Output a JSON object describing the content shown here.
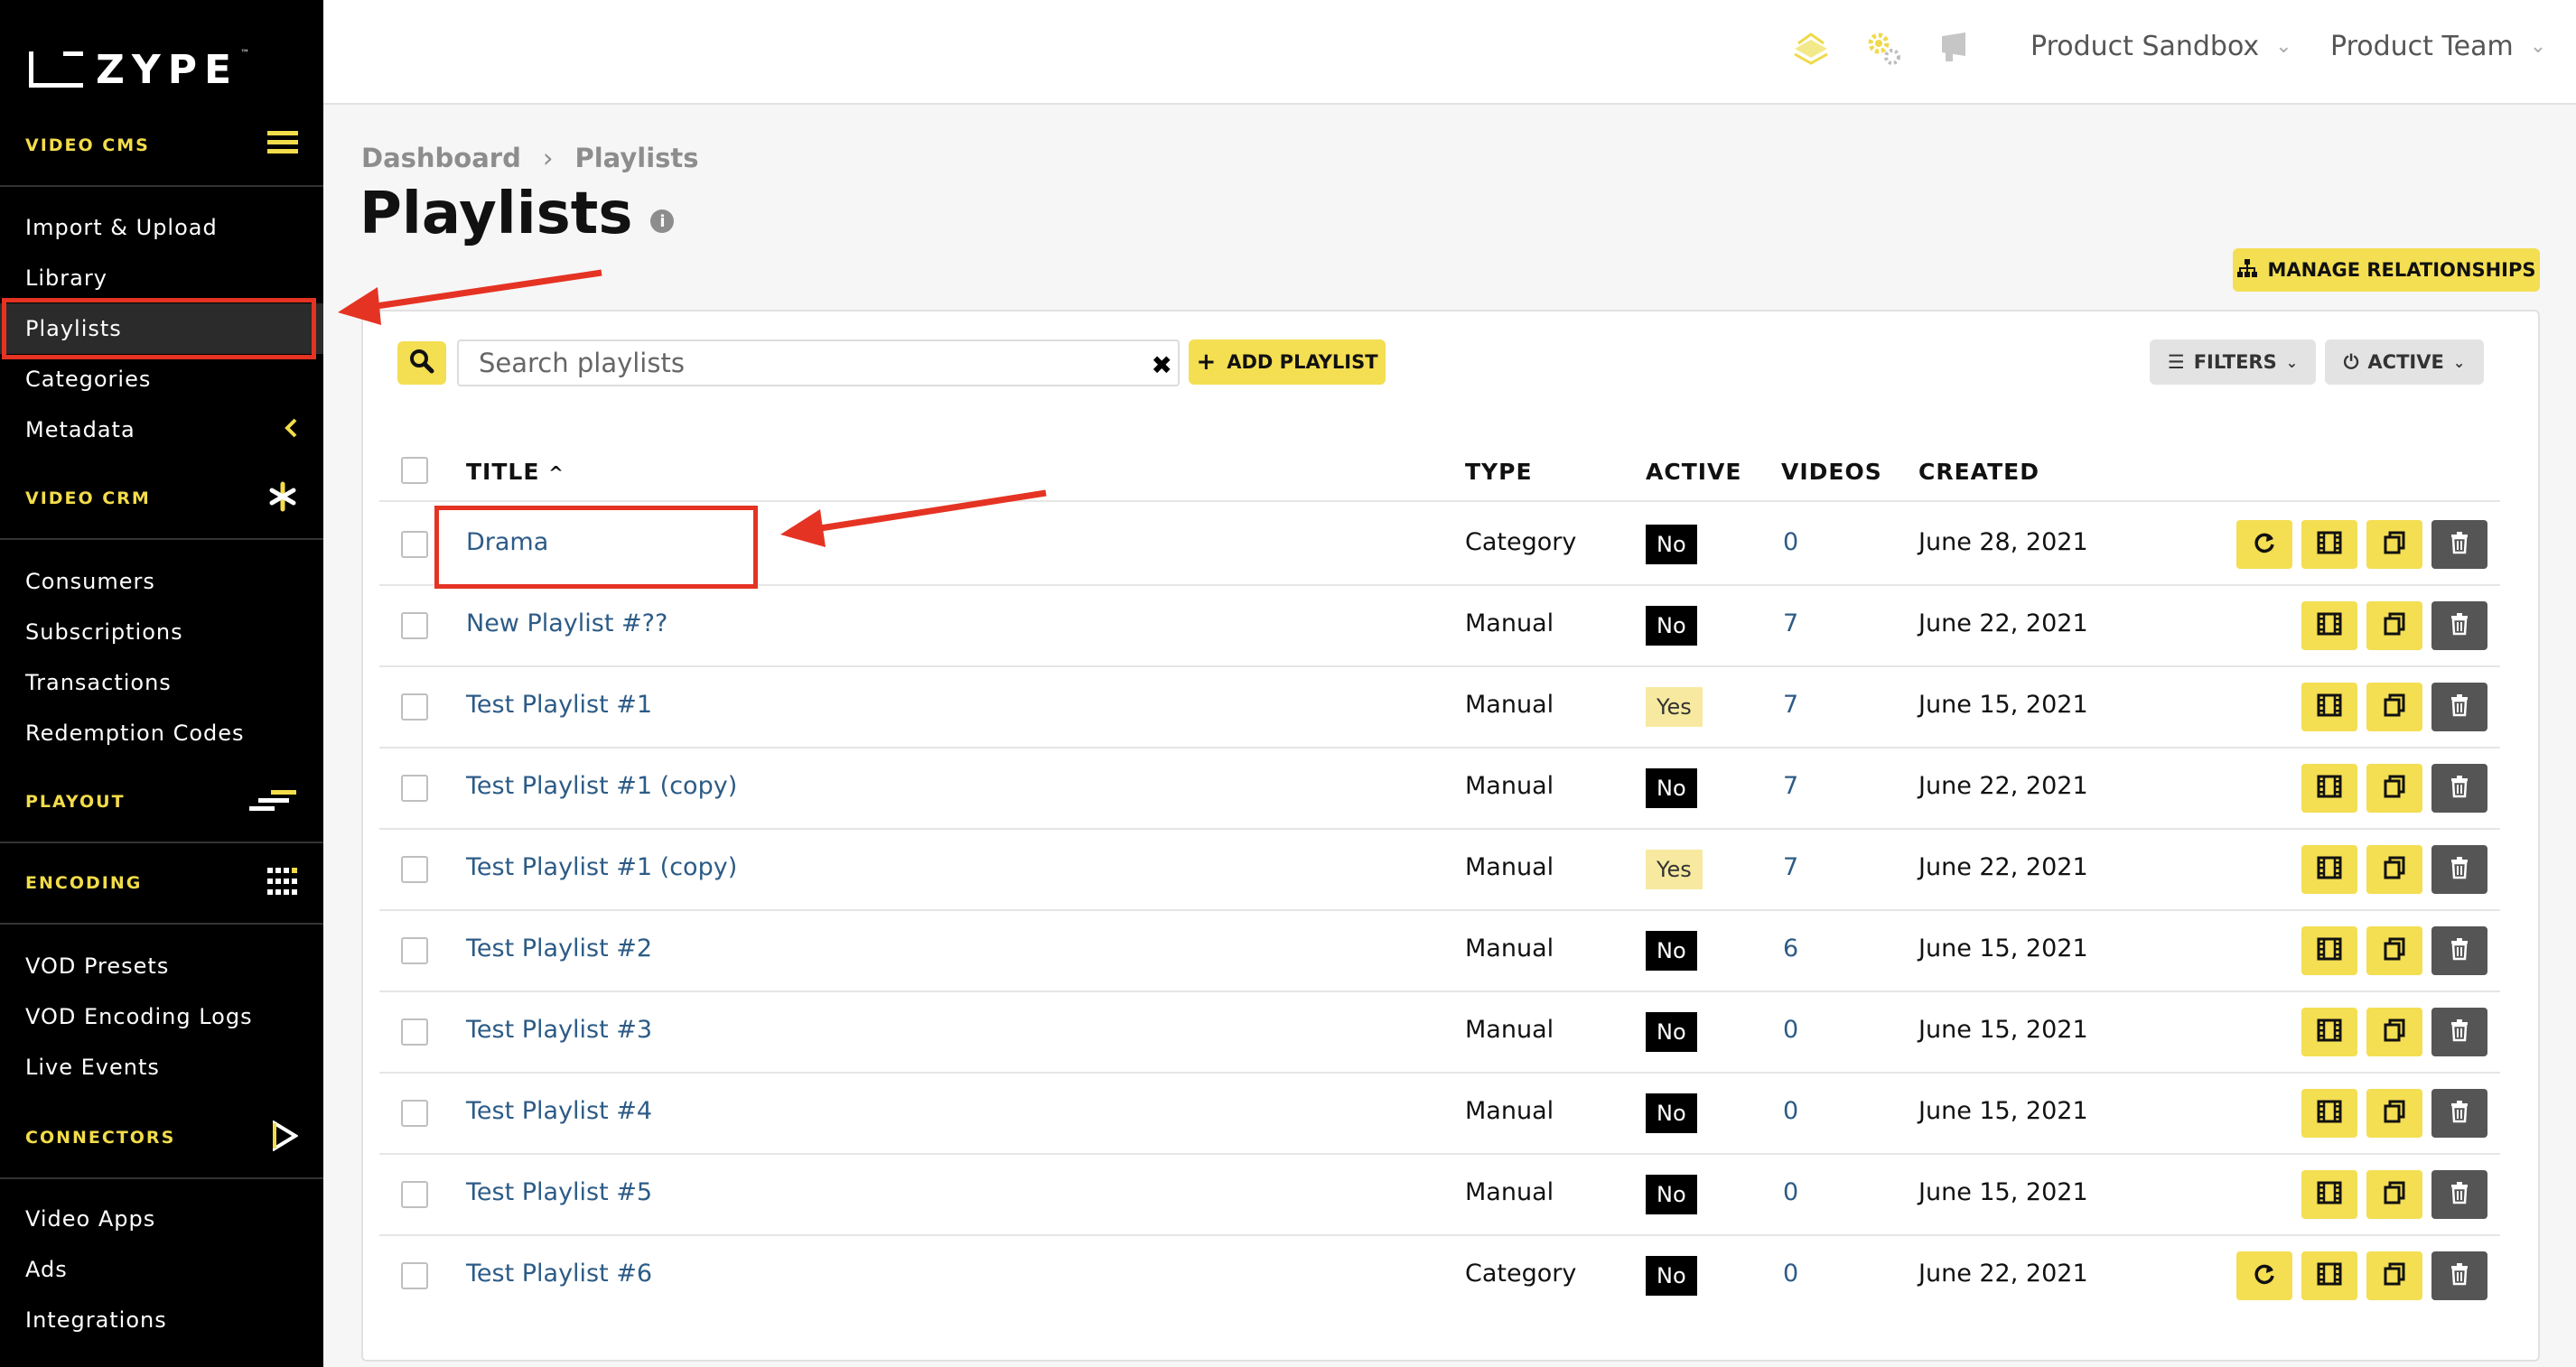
{
  "brand": {
    "logo": "ZYPE",
    "tm": "™"
  },
  "sidebar": {
    "sections": [
      {
        "label": "VIDEO CMS",
        "icon": "hamburger-icon",
        "items": [
          "Import & Upload",
          "Library",
          "Playlists",
          "Categories",
          "Metadata"
        ]
      },
      {
        "label": "VIDEO CRM",
        "icon": "asterisk-icon",
        "items": [
          "Consumers",
          "Subscriptions",
          "Transactions",
          "Redemption Codes"
        ]
      },
      {
        "label": "PLAYOUT",
        "icon": "playout-icon",
        "items": []
      },
      {
        "label": "ENCODING",
        "icon": "grid-icon",
        "items": [
          "VOD Presets",
          "VOD Encoding Logs",
          "Live Events"
        ]
      },
      {
        "label": "CONNECTORS",
        "icon": "play-icon",
        "items": [
          "Video Apps",
          "Ads",
          "Integrations"
        ]
      }
    ],
    "active_item": "Playlists"
  },
  "topbar": {
    "sandbox": "Product Sandbox",
    "team": "Product Team"
  },
  "breadcrumb": {
    "root": "Dashboard",
    "current": "Playlists"
  },
  "page": {
    "title": "Playlists"
  },
  "toolbar": {
    "manage_label": "MANAGE RELATIONSHIPS",
    "search_placeholder": "Search playlists",
    "add_label": "ADD PLAYLIST",
    "filters_label": "FILTERS",
    "active_label": "ACTIVE"
  },
  "table": {
    "headers": {
      "title": "TITLE",
      "type": "TYPE",
      "active": "ACTIVE",
      "videos": "VIDEOS",
      "created": "CREATED"
    },
    "rows": [
      {
        "title": "Drama",
        "type": "Category",
        "active": "No",
        "videos": "0",
        "created": "June 28, 2021"
      },
      {
        "title": "New Playlist #??",
        "type": "Manual",
        "active": "No",
        "videos": "7",
        "created": "June 22, 2021"
      },
      {
        "title": "Test Playlist #1",
        "type": "Manual",
        "active": "Yes",
        "videos": "7",
        "created": "June 15, 2021"
      },
      {
        "title": "Test Playlist #1 (copy)",
        "type": "Manual",
        "active": "No",
        "videos": "7",
        "created": "June 22, 2021"
      },
      {
        "title": "Test Playlist #1 (copy)",
        "type": "Manual",
        "active": "Yes",
        "videos": "7",
        "created": "June 22, 2021"
      },
      {
        "title": "Test Playlist #2",
        "type": "Manual",
        "active": "No",
        "videos": "6",
        "created": "June 15, 2021"
      },
      {
        "title": "Test Playlist #3",
        "type": "Manual",
        "active": "No",
        "videos": "0",
        "created": "June 15, 2021"
      },
      {
        "title": "Test Playlist #4",
        "type": "Manual",
        "active": "No",
        "videos": "0",
        "created": "June 15, 2021"
      },
      {
        "title": "Test Playlist #5",
        "type": "Manual",
        "active": "No",
        "videos": "0",
        "created": "June 15, 2021"
      },
      {
        "title": "Test Playlist #6",
        "type": "Category",
        "active": "No",
        "videos": "0",
        "created": "June 22, 2021"
      }
    ]
  },
  "colors": {
    "accent": "#f4de52",
    "link": "#2c5b86",
    "annotation": "#e53323"
  }
}
